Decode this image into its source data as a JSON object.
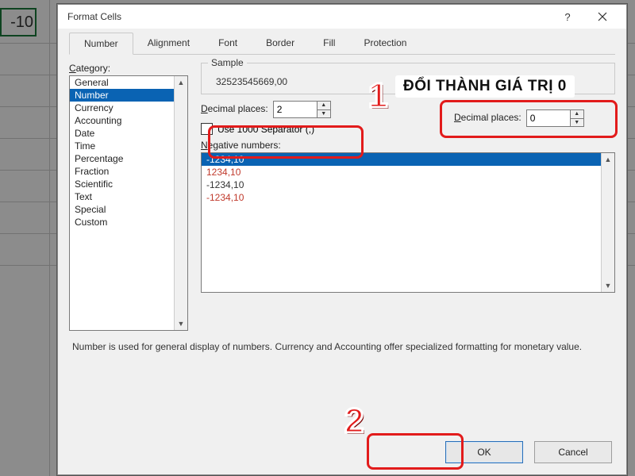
{
  "sheet": {
    "selected_cell_value": "-10"
  },
  "dialog": {
    "title": "Format Cells",
    "tabs": [
      "Number",
      "Alignment",
      "Font",
      "Border",
      "Fill",
      "Protection"
    ],
    "active_tab": 0,
    "category_label": "Category:",
    "category_u": "C",
    "categories": [
      "General",
      "Number",
      "Currency",
      "Accounting",
      "Date",
      "Time",
      "Percentage",
      "Fraction",
      "Scientific",
      "Text",
      "Special",
      "Custom"
    ],
    "category_sel": 1,
    "sample_label": "Sample",
    "sample_value": "32523545669,00",
    "decimal_label": "Decimal places:",
    "decimal_u": "D",
    "decimal_value": "2",
    "sep_label": "Use 1000 Separator (,)",
    "sep_u": "U",
    "neg_label": "Negative numbers:",
    "neg_u": "N",
    "neg_items": [
      {
        "text": "-1234,10",
        "color": "#fff",
        "sel": true
      },
      {
        "text": "1234,10",
        "color": "#c0392b"
      },
      {
        "text": "-1234,10",
        "color": "#333"
      },
      {
        "text": "-1234,10",
        "color": "#c0392b"
      }
    ],
    "description": "Number is used for general display of numbers.  Currency and Accounting offer specialized formatting for monetary value.",
    "ok": "OK",
    "cancel": "Cancel"
  },
  "annot": {
    "banner": "ĐỔI THÀNH GIÁ TRỊ 0",
    "badge1": "1",
    "badge2": "2",
    "float_decimal_value": "0"
  }
}
